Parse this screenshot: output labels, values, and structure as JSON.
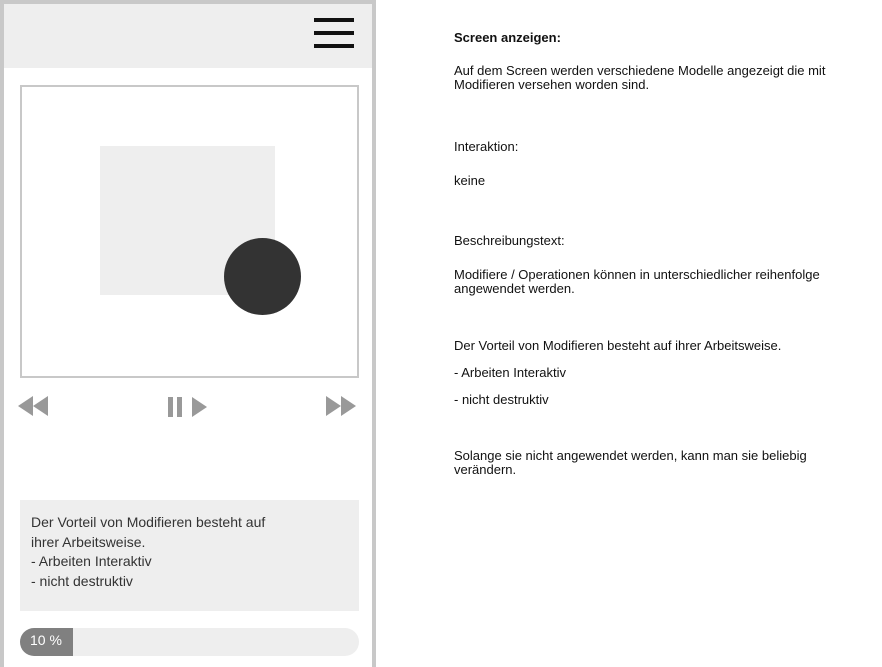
{
  "mockup": {
    "description_lines": [
      "Der Vorteil von Modifieren besteht auf",
      "ihrer Arbeitsweise.",
      "- Arbeiten Interaktiv",
      "- nicht destruktiv"
    ],
    "progress": {
      "value": 10,
      "label": "10 %"
    },
    "icons": [
      "menu-icon",
      "rewind-icon",
      "pause-icon",
      "play-icon",
      "fast-forward-icon"
    ]
  },
  "notes": {
    "screen_title": "Screen anzeigen:",
    "screen_text_1": "Auf dem Screen werden verschiedene Modelle angezeigt die mit",
    "screen_text_2": "Modifieren versehen worden sind.",
    "interaction_title": "Interaktion:",
    "interaction_text": "keine",
    "desc_title": "Beschreibungstext:",
    "desc_1a": "Modifiere / Operationen können in unterschiedlicher reihenfolge",
    "desc_1b": "angewendet werden.",
    "desc_2": "Der Vorteil von Modifieren besteht auf ihrer Arbeitsweise.",
    "desc_3": "- Arbeiten Interaktiv",
    "desc_4": "- nicht destruktiv",
    "desc_5a": "Solange sie nicht angewendet werden, kann man sie beliebig",
    "desc_5b": "verändern."
  }
}
